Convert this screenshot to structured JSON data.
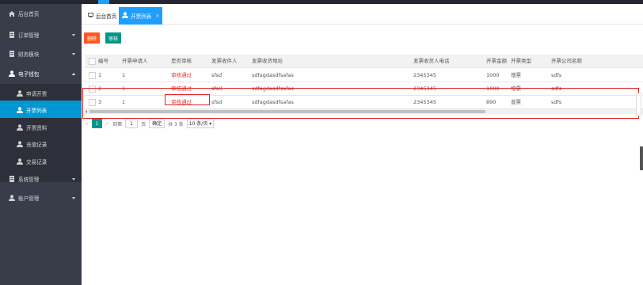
{
  "topbar": {
    "right_text": ""
  },
  "sidebar": {
    "items": [
      {
        "label": "后台首页",
        "icon": "home-icon"
      },
      {
        "label": "订单管理",
        "icon": "doc-icon"
      },
      {
        "label": "财务模块",
        "icon": "doc-icon"
      },
      {
        "label": "电子钱包",
        "icon": "user-icon"
      },
      {
        "label": "系统管理",
        "icon": "doc-icon"
      },
      {
        "label": "账户管理",
        "icon": "user-icon"
      }
    ],
    "sub_items": [
      {
        "label": "申请开票"
      },
      {
        "label": "开票列表"
      },
      {
        "label": "开票资料"
      },
      {
        "label": "充值记录"
      },
      {
        "label": "交易记录"
      }
    ]
  },
  "tabs": [
    {
      "label": "后台首页"
    },
    {
      "label": "开票列表"
    }
  ],
  "toolbar": {
    "delete_label": "删除",
    "audit_label": "审核"
  },
  "table": {
    "headers": [
      "编号",
      "开票申请人",
      "是否审核",
      "发票收件人",
      "发票收货地址",
      "发票收货人电话",
      "开票金额",
      "开票类型",
      "开票公司名称"
    ],
    "rows": [
      [
        "1",
        "1",
        "审核通过",
        "sfsd",
        "sdfagdasdfsafas",
        "2345345",
        "1000",
        "增票",
        "sdfs"
      ],
      [
        "2",
        "1",
        "审核通过",
        "sfsd",
        "sdfagdasdfsafas",
        "2345345",
        "1000",
        "增票",
        "sdfs"
      ],
      [
        "3",
        "1",
        "审核通过",
        "sfsd",
        "sdfagdasdfsafas",
        "2345345",
        "890",
        "普票",
        "sdfs"
      ]
    ]
  },
  "pager": {
    "prev": "<",
    "current": "1",
    "next": ">",
    "goto_label": "到第",
    "page_input": "1",
    "page_unit": "页",
    "confirm": "确定",
    "total": "共 3 条",
    "per_page": "10 条/页"
  },
  "colors": {
    "sidebar_bg": "#393d49",
    "active": "#0096d2",
    "tab_active": "#1e9fff",
    "delete": "#ff5722",
    "audit": "#009688",
    "pass_text": "#e33333",
    "highlight": "#e02020"
  }
}
